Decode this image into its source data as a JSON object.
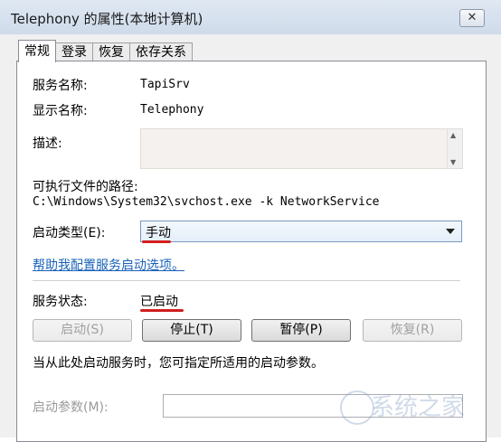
{
  "window": {
    "title": "Telephony 的属性(本地计算机)",
    "close_glyph": "✕"
  },
  "tabs": [
    {
      "label": "常规",
      "active": true
    },
    {
      "label": "登录",
      "active": false
    },
    {
      "label": "恢复",
      "active": false
    },
    {
      "label": "依存关系",
      "active": false
    }
  ],
  "general": {
    "service_name_label": "服务名称:",
    "service_name_value": "TapiSrv",
    "display_name_label": "显示名称:",
    "display_name_value": "Telephony",
    "description_label": "描述:",
    "exe_path_label": "可执行文件的路径:",
    "exe_path_value": "C:\\Windows\\System32\\svchost.exe -k NetworkService",
    "startup_type_label": "启动类型(E):",
    "startup_type_value": "手动",
    "help_link": "帮助我配置服务启动选项。",
    "status_label": "服务状态:",
    "status_value": "已启动",
    "buttons": {
      "start": "启动(S)",
      "stop": "停止(T)",
      "pause": "暂停(P)",
      "resume": "恢复(R)"
    },
    "hint": "当从此处启动服务时，您可指定所适用的启动参数。",
    "start_params_label": "启动参数(M):"
  },
  "watermark": "系统之家",
  "colors": {
    "link": "#1a63b8",
    "annotation_red": "#d21e1e"
  }
}
